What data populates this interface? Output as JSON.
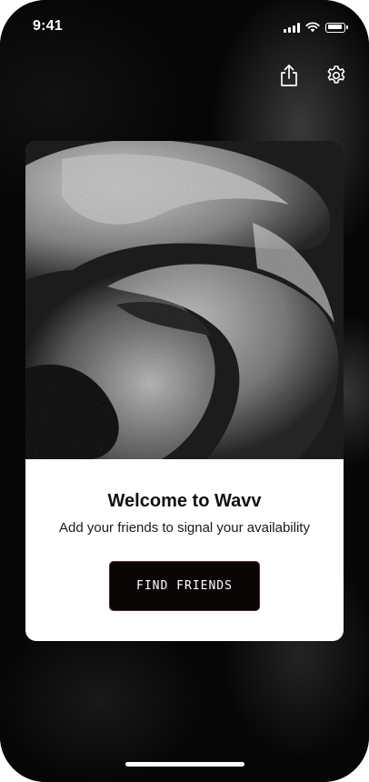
{
  "status_bar": {
    "time": "9:41",
    "icons": [
      "cellular-signal-icon",
      "wifi-icon",
      "battery-icon"
    ]
  },
  "header_actions": {
    "icons": [
      "share-icon",
      "settings-gear-icon"
    ]
  },
  "welcome_card": {
    "title": "Welcome to Wavv",
    "subtitle": "Add your friends to signal your availability",
    "cta_label": "FIND FRIENDS"
  },
  "colors": {
    "background": "#050505",
    "card": "#ffffff",
    "button": "#0a0606",
    "button_border": "#5a2a2a",
    "text_dark": "#111111",
    "text_light": "#ffffff"
  }
}
